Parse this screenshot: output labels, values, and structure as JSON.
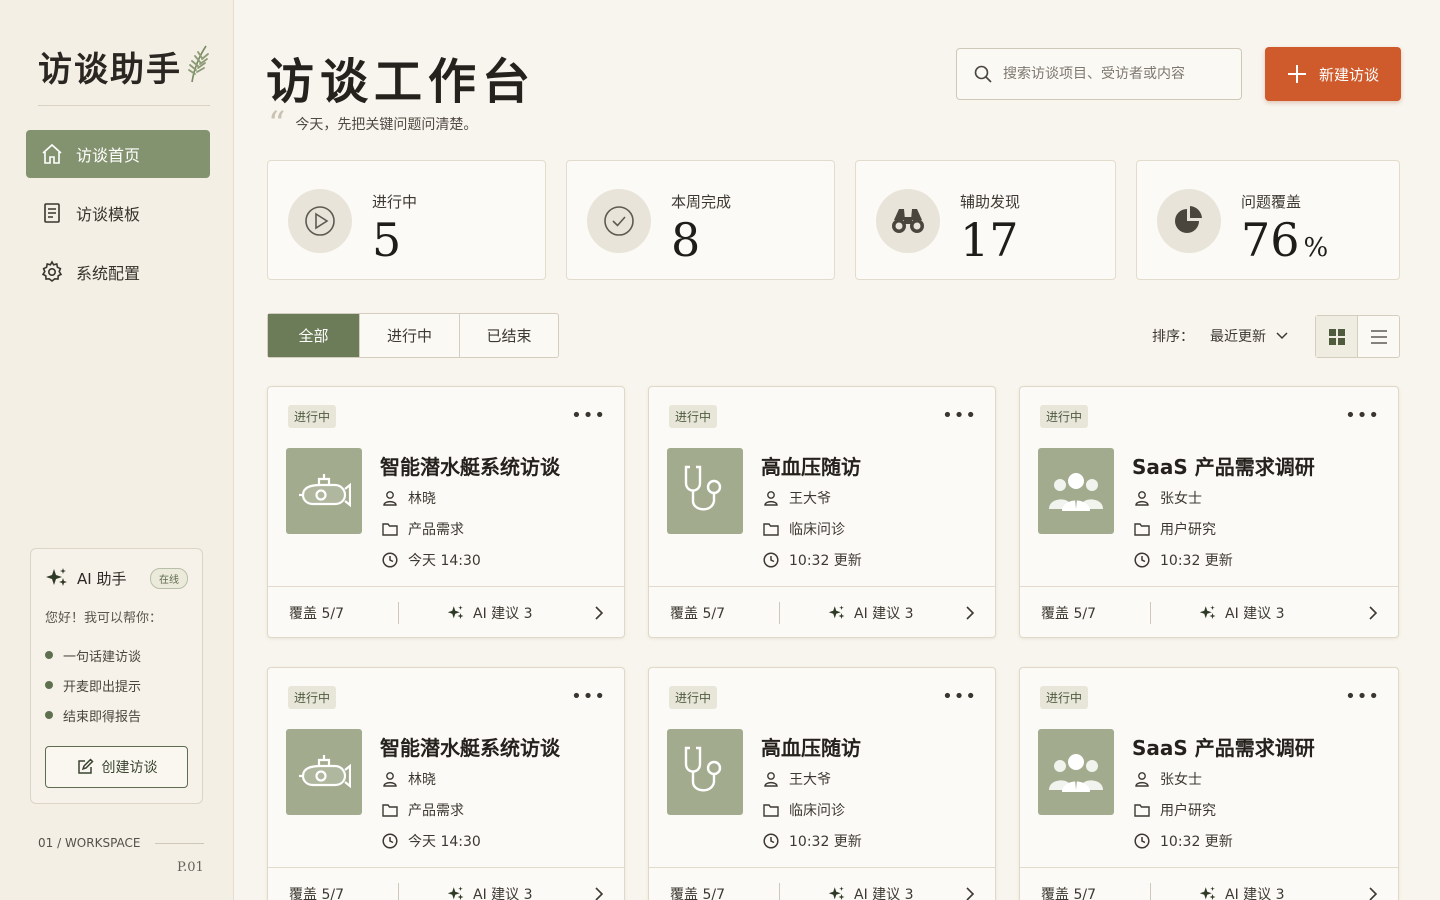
{
  "sidebar": {
    "brand": "访谈助手",
    "nav": [
      {
        "label": "访谈首页",
        "icon": "home-icon",
        "active": true
      },
      {
        "label": "访谈模板",
        "icon": "document-icon",
        "active": false
      },
      {
        "label": "系统配置",
        "icon": "gear-icon",
        "active": false
      }
    ],
    "ai": {
      "title": "AI 助手",
      "status": "在线",
      "greeting": "您好！我可以帮你：",
      "items": [
        "一句话建访谈",
        "开麦即出提示",
        "结束即得报告"
      ],
      "button": "创建访谈"
    },
    "workspace": "01 / WORKSPACE",
    "page": "P.01"
  },
  "header": {
    "title": "访谈工作台",
    "subtitle": "今天，先把关键问题问清楚。",
    "search_placeholder": "搜索访谈项目、受访者或内容",
    "new_button": "新建访谈"
  },
  "stats": [
    {
      "label": "进行中",
      "value": "5",
      "unit": "",
      "icon": "play-icon"
    },
    {
      "label": "本周完成",
      "value": "8",
      "unit": "",
      "icon": "check-circle-icon"
    },
    {
      "label": "辅助发现",
      "value": "17",
      "unit": "",
      "icon": "binoculars-icon"
    },
    {
      "label": "问题覆盖",
      "value": "76",
      "unit": "%",
      "icon": "pie-chart-icon"
    }
  ],
  "filters": {
    "tabs": [
      "全部",
      "进行中",
      "已结束"
    ],
    "sort_label": "排序：",
    "sort_value": "最近更新"
  },
  "cards": [
    {
      "status": "进行中",
      "title": "智能潜水艇系统访谈",
      "person": "林晓",
      "category": "产品需求",
      "time": "今天 14:30",
      "coverage": "覆盖  5/7",
      "ai": "AI 建议  3",
      "thumb": "submarine-icon"
    },
    {
      "status": "进行中",
      "title": "高血压随访",
      "person": "王大爷",
      "category": "临床问诊",
      "time": "10:32 更新",
      "coverage": "覆盖  5/7",
      "ai": "AI 建议  3",
      "thumb": "stethoscope-icon"
    },
    {
      "status": "进行中",
      "title": "SaaS 产品需求调研",
      "person": "张女士",
      "category": "用户研究",
      "time": "10:32 更新",
      "coverage": "覆盖  5/7",
      "ai": "AI 建议  3",
      "thumb": "people-group-icon"
    },
    {
      "status": "进行中",
      "title": "智能潜水艇系统访谈",
      "person": "林晓",
      "category": "产品需求",
      "time": "今天 14:30",
      "coverage": "覆盖  5/7",
      "ai": "AI 建议  3",
      "thumb": "submarine-icon"
    },
    {
      "status": "进行中",
      "title": "高血压随访",
      "person": "王大爷",
      "category": "临床问诊",
      "time": "10:32 更新",
      "coverage": "覆盖  5/7",
      "ai": "AI 建议  3",
      "thumb": "stethoscope-icon"
    },
    {
      "status": "进行中",
      "title": "SaaS 产品需求调研",
      "person": "张女士",
      "category": "用户研究",
      "time": "10:32 更新",
      "coverage": "覆盖  5/7",
      "ai": "AI 建议  3",
      "thumb": "people-group-icon"
    }
  ],
  "colors": {
    "accent": "#cf5a2b",
    "sage": "#84936f",
    "sage_dark": "#6d7c58",
    "background": "#f8f5ee"
  }
}
